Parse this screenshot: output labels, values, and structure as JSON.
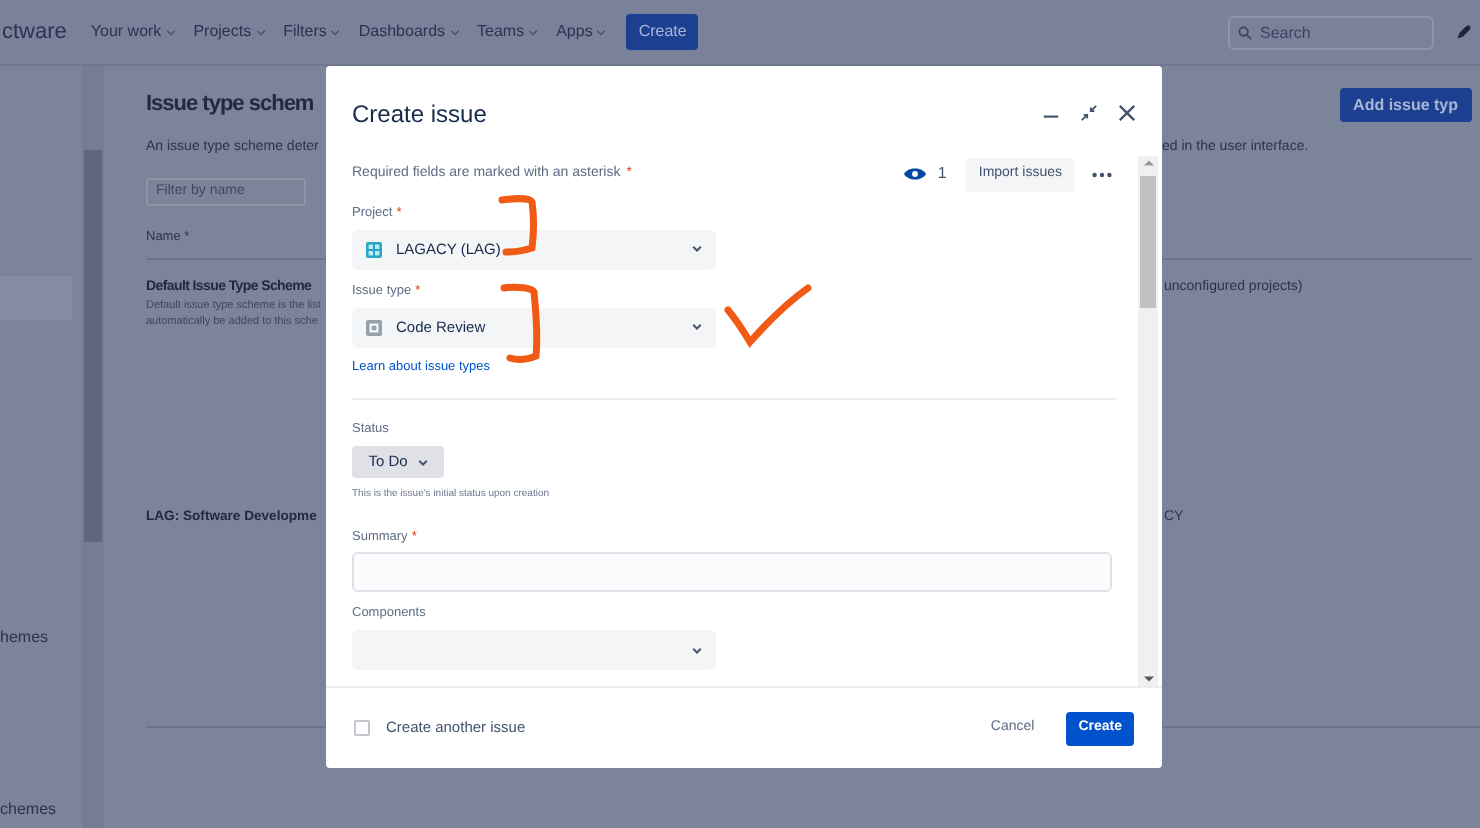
{
  "nav": {
    "brand": "ctware",
    "items": [
      {
        "label": "Your work"
      },
      {
        "label": "Projects"
      },
      {
        "label": "Filters"
      },
      {
        "label": "Dashboards"
      },
      {
        "label": "Teams"
      },
      {
        "label": "Apps"
      }
    ],
    "create": "Create",
    "search": {
      "placeholder": "Search"
    }
  },
  "sidebar": {
    "items": [
      {
        "label": "hemes"
      },
      {
        "label": "chemes"
      }
    ]
  },
  "page": {
    "title": "Issue type schem",
    "add_button": "Add issue typ",
    "description_left": "An issue type scheme deter",
    "description_right": "ed in the user interface.",
    "filter": {
      "placeholder": "Filter by name"
    },
    "column_header": "Name *",
    "rows": [
      {
        "name": "Default Issue Type Scheme",
        "details": [
          "Default issue type scheme is the list",
          "automatically be added to this sche"
        ],
        "right": "unconfigured projects)"
      },
      {
        "name": "LAG: Software Developme",
        "details": [],
        "right": "CY"
      }
    ]
  },
  "modal": {
    "title": "Create issue",
    "required_note": "Required fields are marked with an asterisk",
    "asterisk": "*",
    "watchers": "1",
    "import_button": "Import issues",
    "fields": [
      {
        "kind": "select",
        "label": "Project",
        "required": true,
        "value": "LAGACY (LAG)"
      },
      {
        "kind": "select",
        "label": "Issue type",
        "required": true,
        "value": "Code Review",
        "link": "Learn about issue types"
      },
      {
        "kind": "divider"
      },
      {
        "kind": "status",
        "label": "Status",
        "value": "To Do",
        "help": "This is the issue's initial status upon creation"
      },
      {
        "kind": "text",
        "label": "Summary",
        "required": true
      },
      {
        "kind": "select",
        "label": "Components",
        "required": false
      }
    ],
    "create_another": {
      "label": "Create another issue",
      "checked": false
    },
    "cancel": "Cancel",
    "submit": "Create"
  }
}
